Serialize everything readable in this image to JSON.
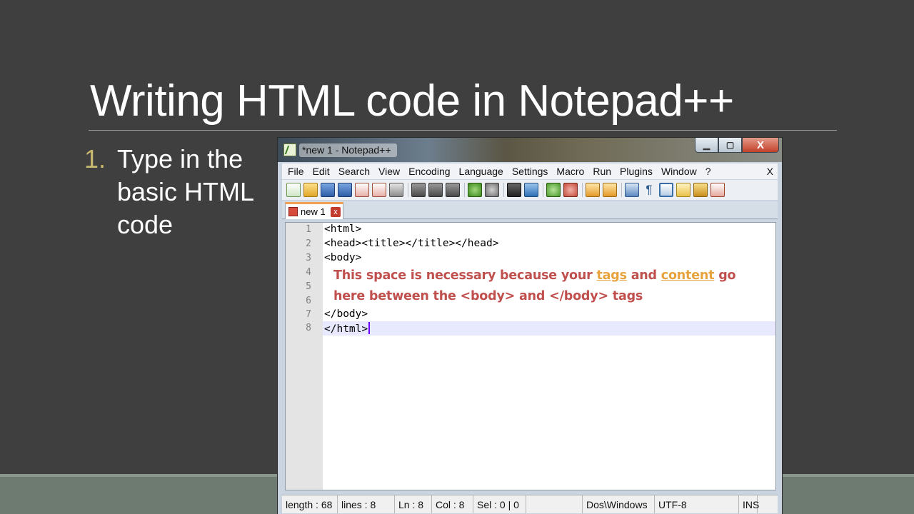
{
  "slide": {
    "title": "Writing HTML code in Notepad++",
    "bullet_number": "1.",
    "bullet_text": "Type in the basic HTML code"
  },
  "window": {
    "title": "*new 1 - Notepad++",
    "close_glyph": "X",
    "menu": [
      "File",
      "Edit",
      "Search",
      "View",
      "Encoding",
      "Language",
      "Settings",
      "Macro",
      "Run",
      "Plugins",
      "Window",
      "?"
    ],
    "menu_close": "X",
    "tab_label": "new 1",
    "tab_close": "x"
  },
  "editor": {
    "line_numbers": [
      "1",
      "2",
      "3",
      "4",
      "5",
      "6",
      "7",
      "8"
    ],
    "lines": [
      "<html>",
      "<head><title></title></head>",
      "<body>",
      "",
      "",
      "",
      "</body>",
      "</html>"
    ],
    "current_line": 8
  },
  "annotation": {
    "part1": "This space is necessary because your ",
    "tags": "tags",
    "part2": " and ",
    "content": "content",
    "part3": " go",
    "line2": "here between the <body> and </body> tags"
  },
  "status": {
    "length": "length : 68",
    "lines": "lines : 8",
    "ln": "Ln : 8",
    "col": "Col : 8",
    "sel": "Sel : 0 | 0",
    "eol": "Dos\\Windows",
    "encoding": "UTF-8",
    "mode": "INS"
  }
}
